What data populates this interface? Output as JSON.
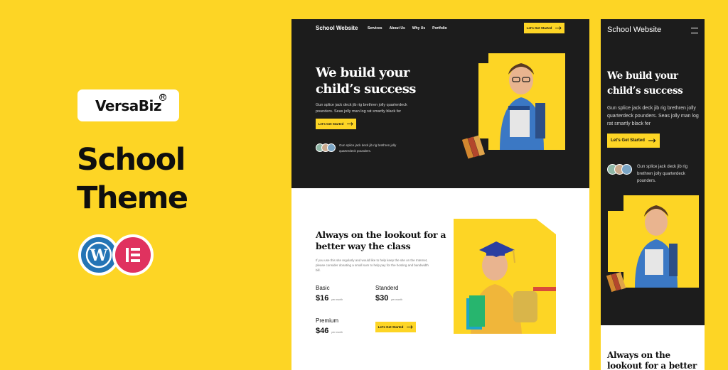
{
  "brand": {
    "name": "VersaBiz",
    "reg": "R"
  },
  "theme_title": [
    "School",
    "Theme"
  ],
  "colors": {
    "accent": "#fdd525",
    "dark": "#1c1c1c",
    "wordpress": "#2474b5",
    "elementor": "#e0325f"
  },
  "icons": [
    "wordpress-icon",
    "elementor-icon",
    "arrow-right-icon",
    "menu-icon"
  ],
  "desktop": {
    "nav": {
      "logo": "School Website",
      "links": [
        "Services",
        "About Us",
        "Why Us",
        "Portfolio"
      ],
      "cta": "Let's Get Started"
    },
    "hero": {
      "heading": "We build your child’s success",
      "text": "Gun splice jack deck jib rig brethren jolly quarterdeck pounders. Seas jolly man log rat smartly black fer",
      "cta": "Let's Get Started",
      "avatars_text": "Gun splice jack deck jib rig brethren jolly quarterdeck pounders."
    },
    "section2": {
      "heading": "Always on the lookout for a better way the class",
      "text": "If you use this site regularly and would like to help keep the site on the Internet, please consider donating a small sum to help pay for the hosting and bandwidth bill.",
      "plans": [
        {
          "name": "Basic",
          "price": "$16",
          "per": "per month"
        },
        {
          "name": "Standerd",
          "price": "$30",
          "per": "per month"
        },
        {
          "name": "Premium",
          "price": "$46",
          "per": "per month"
        }
      ],
      "cta": "Let's Get Started"
    }
  },
  "mobile": {
    "logo": "School Website",
    "hero": {
      "heading": "We build your child’s success",
      "text": "Gun splice jack deck jib rig brethren jolly quarterdeck pounders. Seas jolly man log rat smartly black fer",
      "cta": "Let's Get Started",
      "avatars_text": "Gun splice jack deck jib rig brethren jolly quarterdeck pounders."
    },
    "section2_heading": "Always on the lookout for a better way the"
  }
}
